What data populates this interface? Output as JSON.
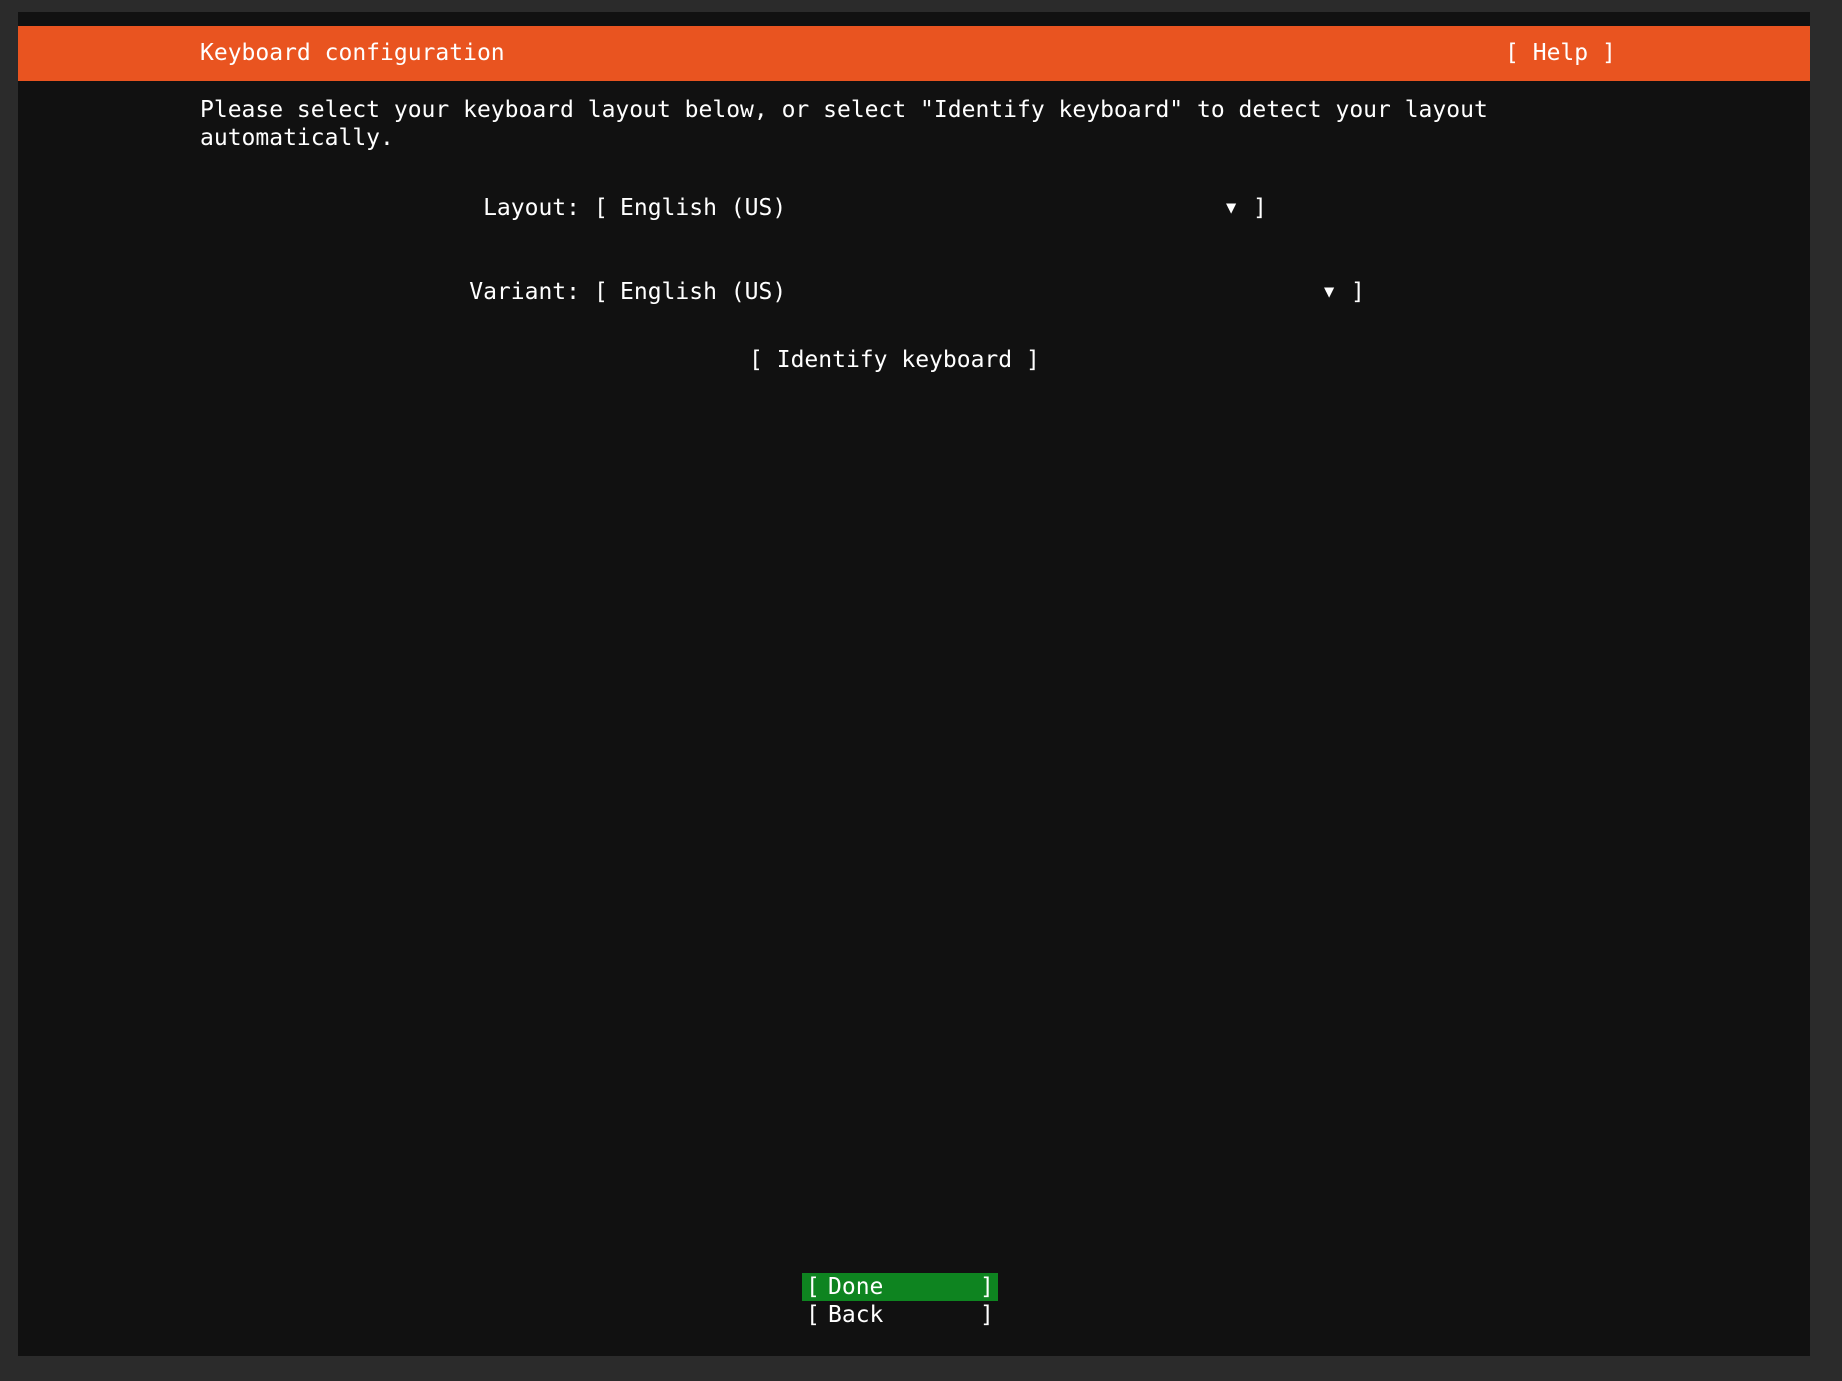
{
  "header": {
    "title": "Keyboard configuration",
    "help_label": "Help",
    "color": "#e95420"
  },
  "intro": "Please select your keyboard layout below, or select \"Identify keyboard\" to detect your layout\nautomatically.",
  "layout": {
    "label": "Layout:",
    "value": "English (US)",
    "arrow_icon": "▼"
  },
  "variant": {
    "label": "Variant:",
    "value": "English (US)",
    "arrow_icon": "▼"
  },
  "identify_button": {
    "label": "Identify keyboard"
  },
  "footer": {
    "done_label": "Done",
    "back_label": "Back",
    "focus_color": "#0e8420"
  },
  "bracket_open": "[",
  "bracket_close": "]"
}
